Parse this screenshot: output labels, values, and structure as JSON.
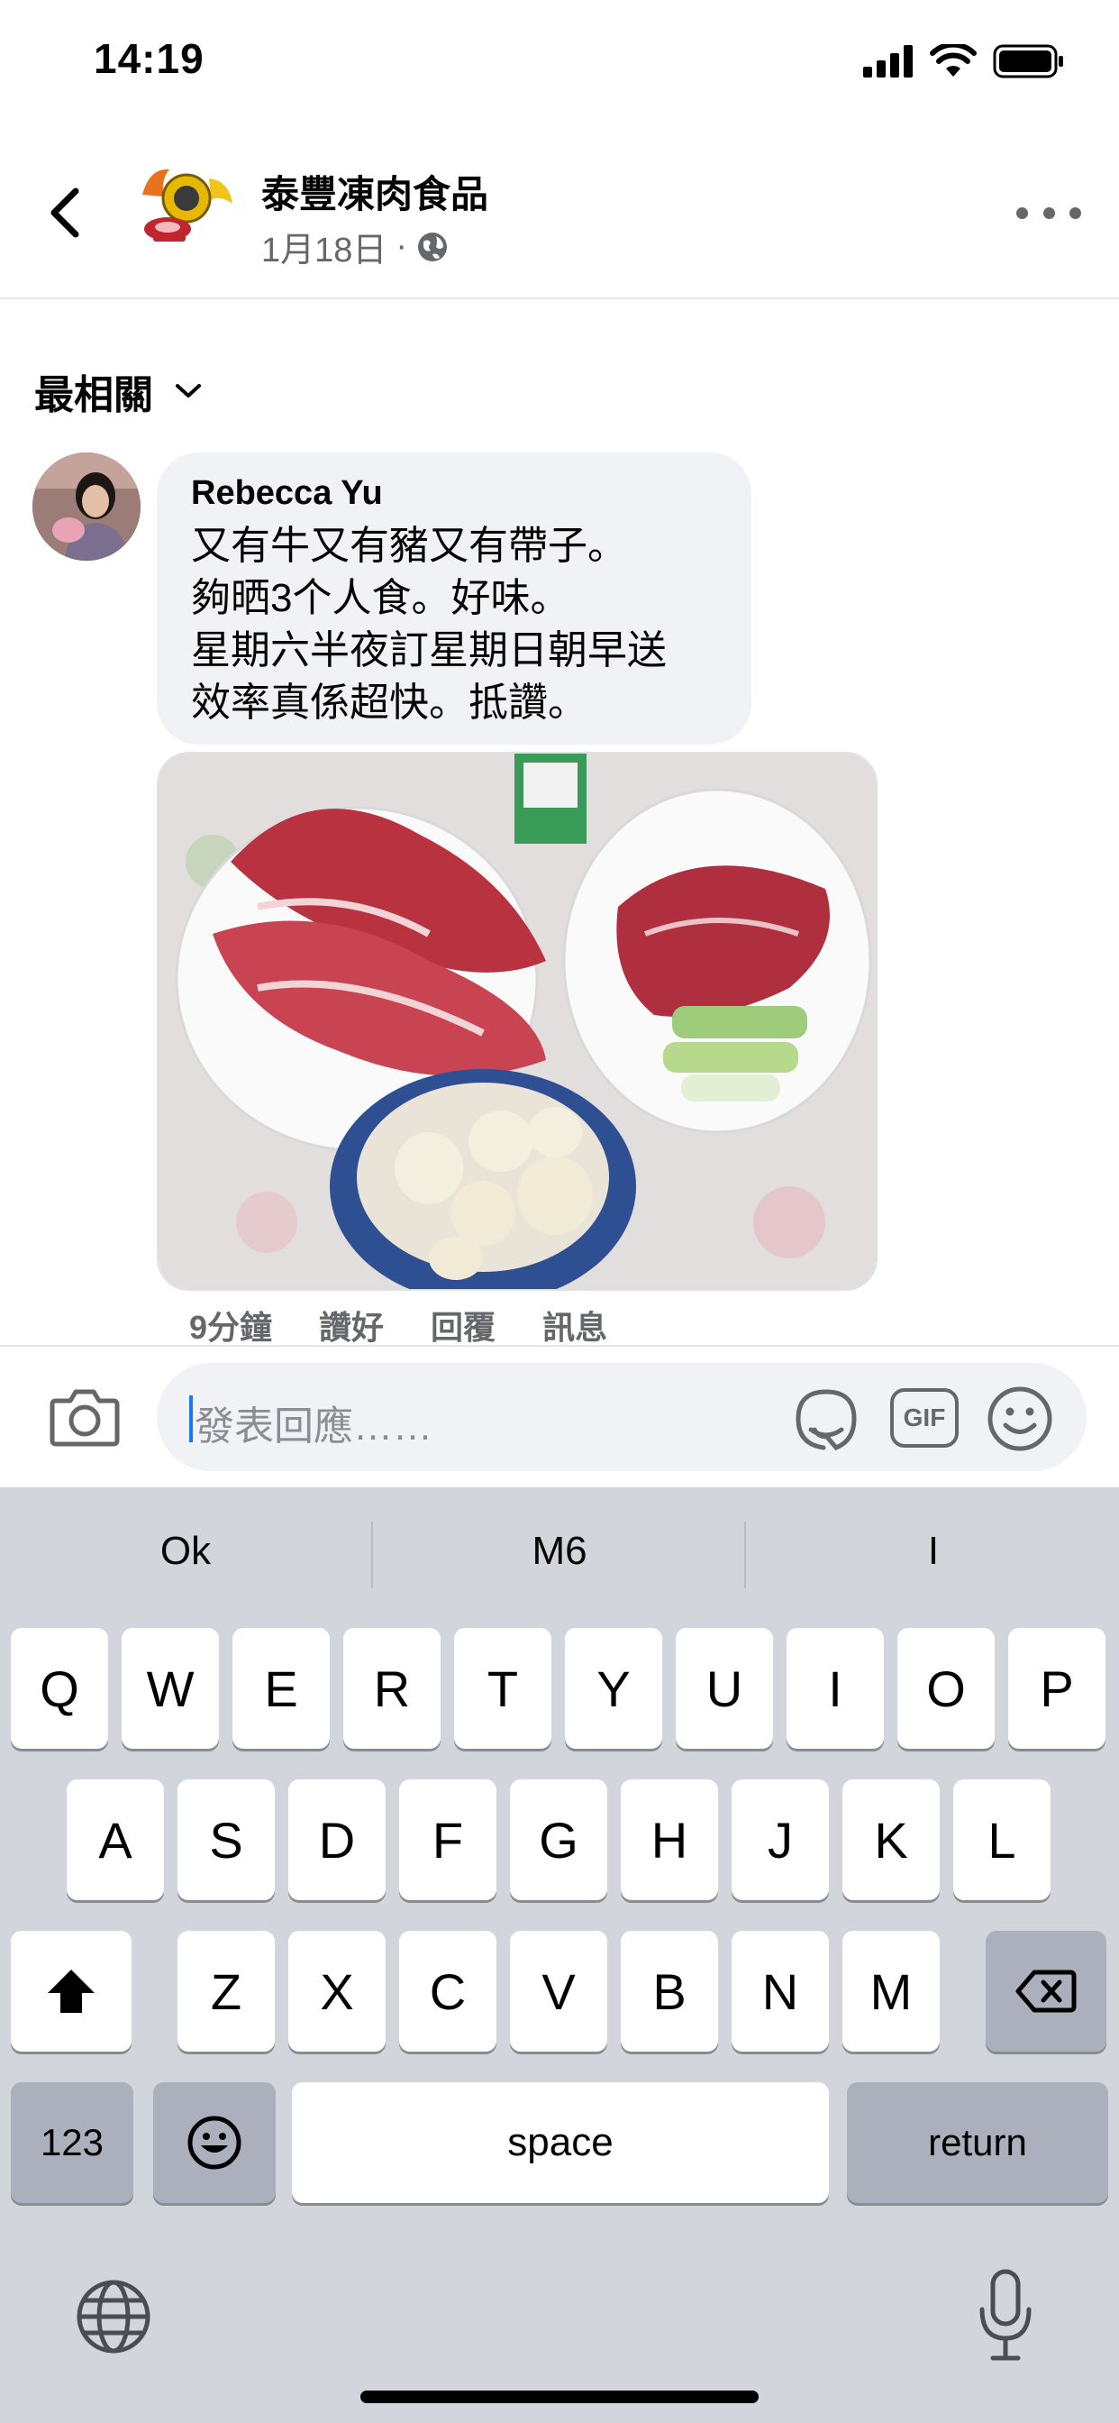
{
  "status_bar": {
    "time": "14:19"
  },
  "header": {
    "page_name": "泰豐凍肉食品",
    "post_date": "1月18日",
    "separator": "·"
  },
  "sort": {
    "label": "最相關"
  },
  "comment": {
    "author": "Rebecca Yu",
    "lines": [
      "又有牛又有豬又有帶子。",
      "夠晒3个人食。好味。",
      "星期六半夜訂星期日朝早送",
      "效率真係超快。抵讚。"
    ],
    "actions": {
      "time": "9分鐘",
      "like": "讚好",
      "reply": "回覆",
      "message": "訊息"
    }
  },
  "composer": {
    "placeholder": "發表回應……",
    "gif_label": "GIF"
  },
  "keyboard": {
    "suggestions": [
      "Ok",
      "M6",
      "I"
    ],
    "row1": [
      "Q",
      "W",
      "E",
      "R",
      "T",
      "Y",
      "U",
      "I",
      "O",
      "P"
    ],
    "row2": [
      "A",
      "S",
      "D",
      "F",
      "G",
      "H",
      "J",
      "K",
      "L"
    ],
    "row3": [
      "Z",
      "X",
      "C",
      "V",
      "B",
      "N",
      "M"
    ],
    "numbers_key": "123",
    "space_key": "space",
    "return_key": "return"
  },
  "colors": {
    "accent": "#1877f2",
    "bubble": "#f0f2f5",
    "keyboard_bg": "#d2d5db",
    "secondary_text": "#65676b"
  }
}
